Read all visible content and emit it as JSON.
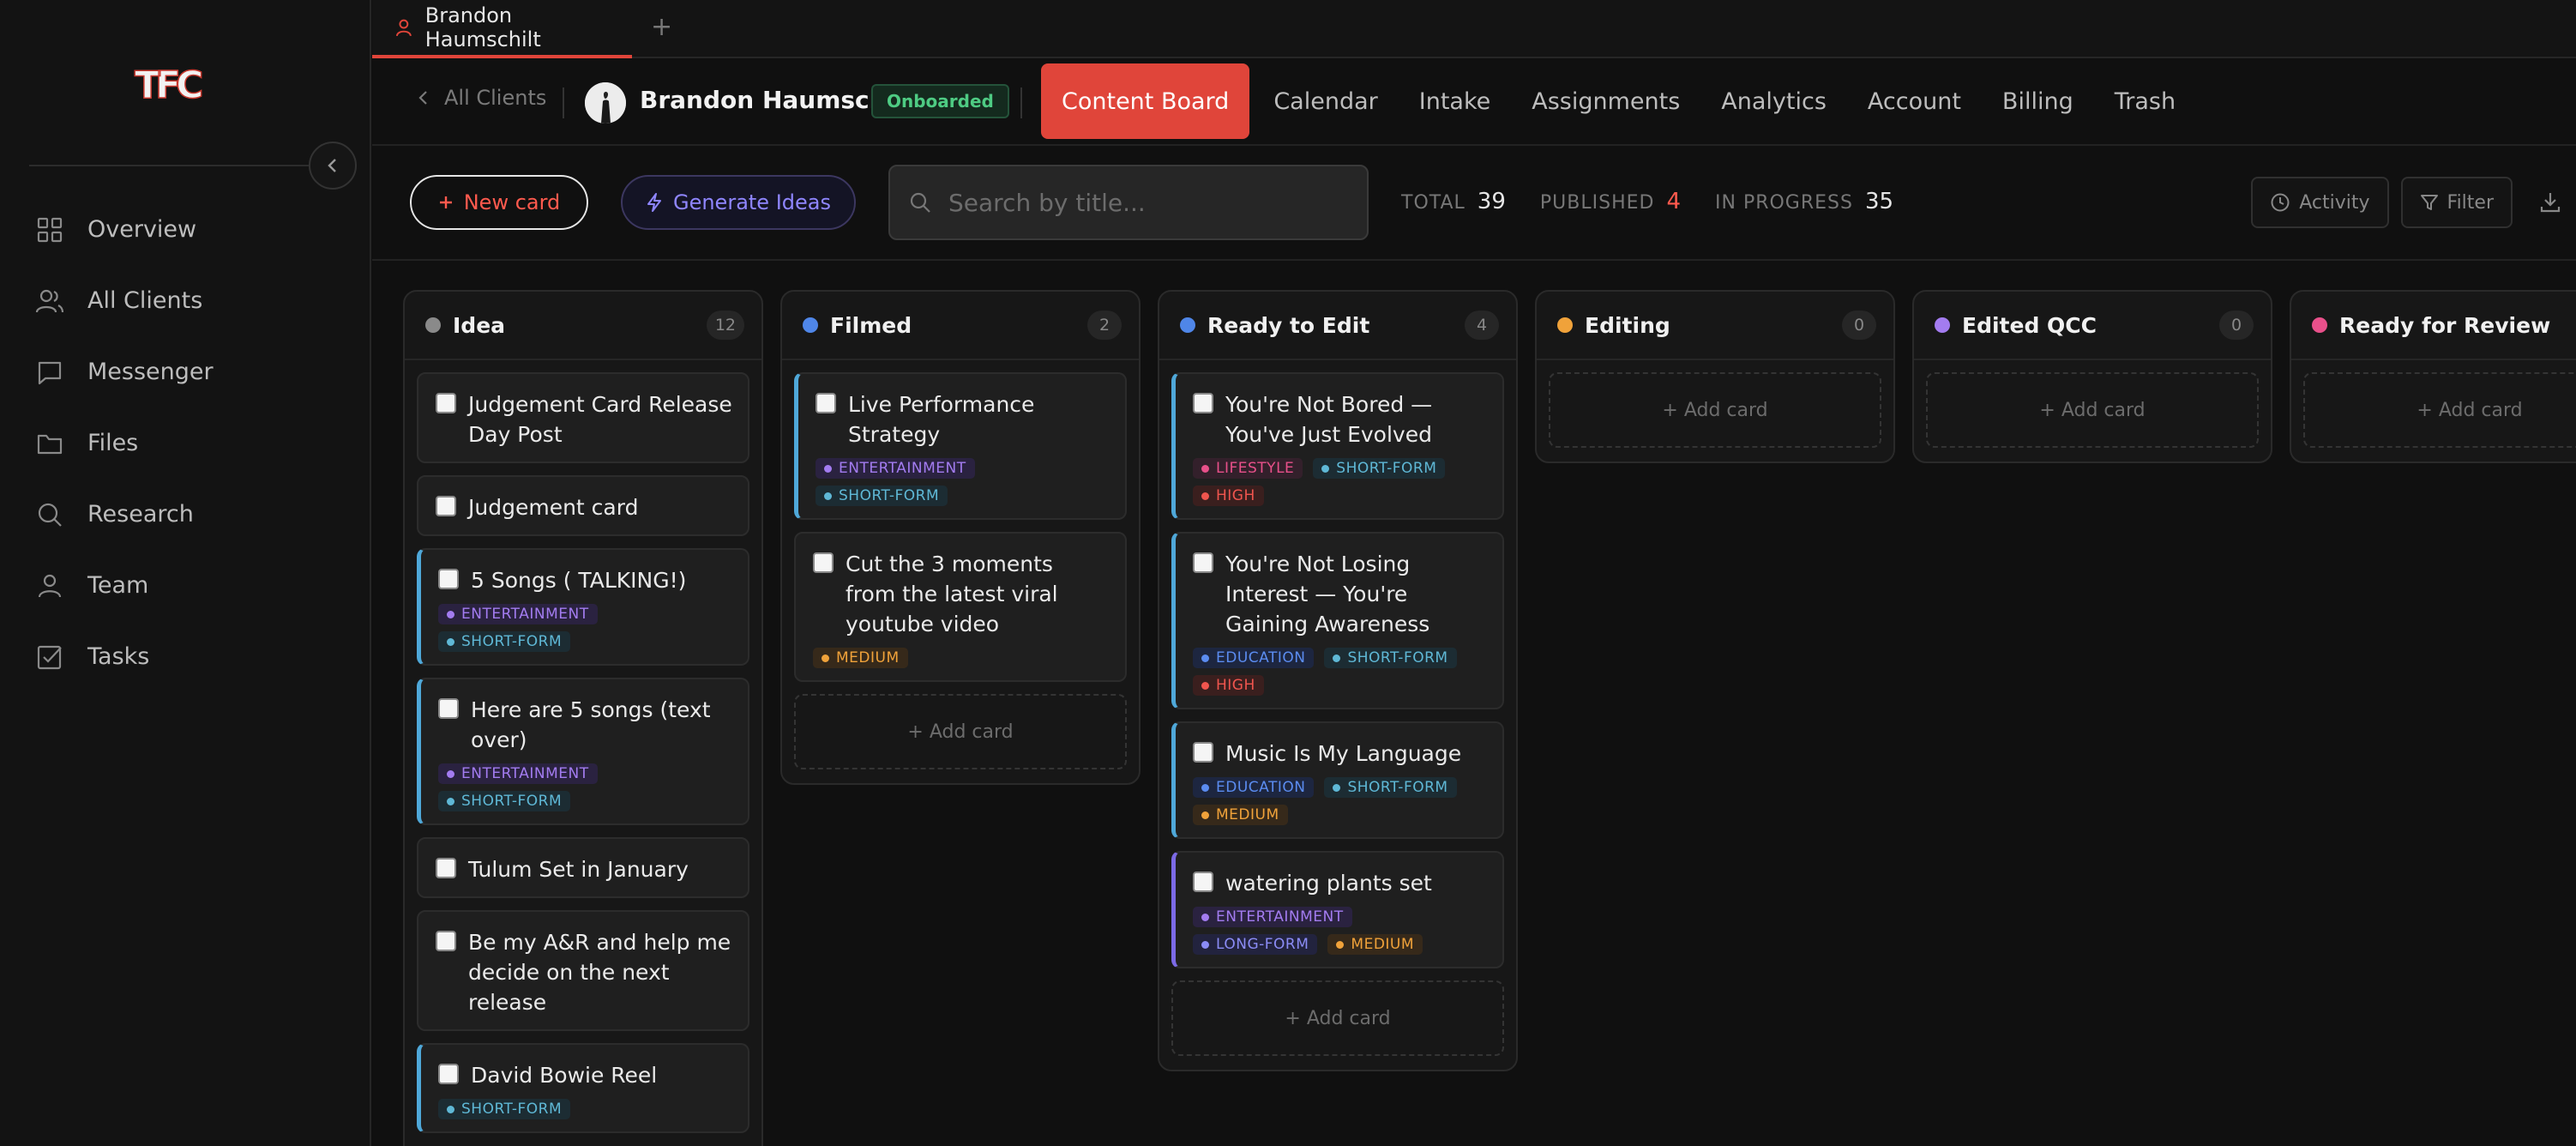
{
  "brand": {
    "logo_text": "TFC"
  },
  "sidebar": {
    "items": [
      {
        "label": "Overview",
        "icon": "grid-icon"
      },
      {
        "label": "All Clients",
        "icon": "users-icon"
      },
      {
        "label": "Messenger",
        "icon": "message-icon"
      },
      {
        "label": "Files",
        "icon": "folder-icon"
      },
      {
        "label": "Research",
        "icon": "search-icon"
      },
      {
        "label": "Team",
        "icon": "user-icon"
      },
      {
        "label": "Tasks",
        "icon": "checkbox-icon"
      }
    ]
  },
  "tabstrip": {
    "tab_label": "Brandon Haumschilt",
    "new_tab": "+"
  },
  "header": {
    "back_label": "All Clients",
    "client_name": "Brandon Haumschilt",
    "status": "Onboarded",
    "tabs": [
      "Content Board",
      "Calendar",
      "Intake",
      "Assignments",
      "Analytics",
      "Account",
      "Billing",
      "Trash"
    ],
    "active_tab": "Content Board"
  },
  "toolbar": {
    "new_card": "New card",
    "generate": "Generate Ideas",
    "search_placeholder": "Search by title...",
    "stats": {
      "total_label": "TOTAL",
      "total": "39",
      "published_label": "PUBLISHED",
      "published": "4",
      "in_progress_label": "IN PROGRESS",
      "in_progress": "35"
    },
    "activity": "Activity",
    "filter": "Filter"
  },
  "colors": {
    "accent": "#e0453a",
    "entertainment": "#a37cf0",
    "short_form": "#5fb8d6",
    "long_form": "#8b8cf5",
    "lifestyle": "#e8508a",
    "education": "#5b8cf0",
    "high": "#f0554e",
    "medium": "#f0a23a"
  },
  "board": {
    "add_card_label": "+ Add card",
    "columns": [
      {
        "title": "Idea",
        "count": "12",
        "dot": "#8a8a8a"
      },
      {
        "title": "Filmed",
        "count": "2",
        "dot": "#4f86e8"
      },
      {
        "title": "Ready to Edit",
        "count": "4",
        "dot": "#4f86e8"
      },
      {
        "title": "Editing",
        "count": "0",
        "dot": "#f0a23a"
      },
      {
        "title": "Edited QCC",
        "count": "0",
        "dot": "#a37cf0"
      },
      {
        "title": "Ready for Review",
        "count": "",
        "dot": "#e8508a"
      }
    ],
    "cards": {
      "idea": [
        {
          "title": "Judgement Card Release Day Post"
        },
        {
          "title": "Judgement card"
        },
        {
          "title": "5 Songs ( TALKING!)",
          "tags": [
            "ENTERTAINMENT",
            "SHORT-FORM"
          ]
        },
        {
          "title": "Here are 5 songs (text over)",
          "tags": [
            "ENTERTAINMENT",
            "SHORT-FORM"
          ]
        },
        {
          "title": "Tulum Set in January"
        },
        {
          "title": "Be my A&R and help me decide on the next release"
        },
        {
          "title": "David Bowie Reel",
          "tags": [
            "SHORT-FORM"
          ]
        }
      ],
      "filmed": [
        {
          "title": "Live Performance Strategy",
          "tags": [
            "ENTERTAINMENT",
            "SHORT-FORM"
          ]
        },
        {
          "title": "Cut the 3 moments from the latest viral youtube video",
          "tags": [
            "MEDIUM"
          ]
        }
      ],
      "ready_to_edit": [
        {
          "title": "You're Not Bored — You've Just Evolved",
          "tags": [
            "LIFESTYLE",
            "SHORT-FORM",
            "HIGH"
          ]
        },
        {
          "title": "You're Not Losing Interest — You're Gaining Awareness",
          "tags": [
            "EDUCATION",
            "SHORT-FORM",
            "HIGH"
          ]
        },
        {
          "title": "Music Is My Language",
          "tags": [
            "EDUCATION",
            "SHORT-FORM",
            "MEDIUM"
          ]
        },
        {
          "title": "watering plants set",
          "tags": [
            "ENTERTAINMENT",
            "LONG-FORM",
            "MEDIUM"
          ]
        }
      ]
    }
  }
}
